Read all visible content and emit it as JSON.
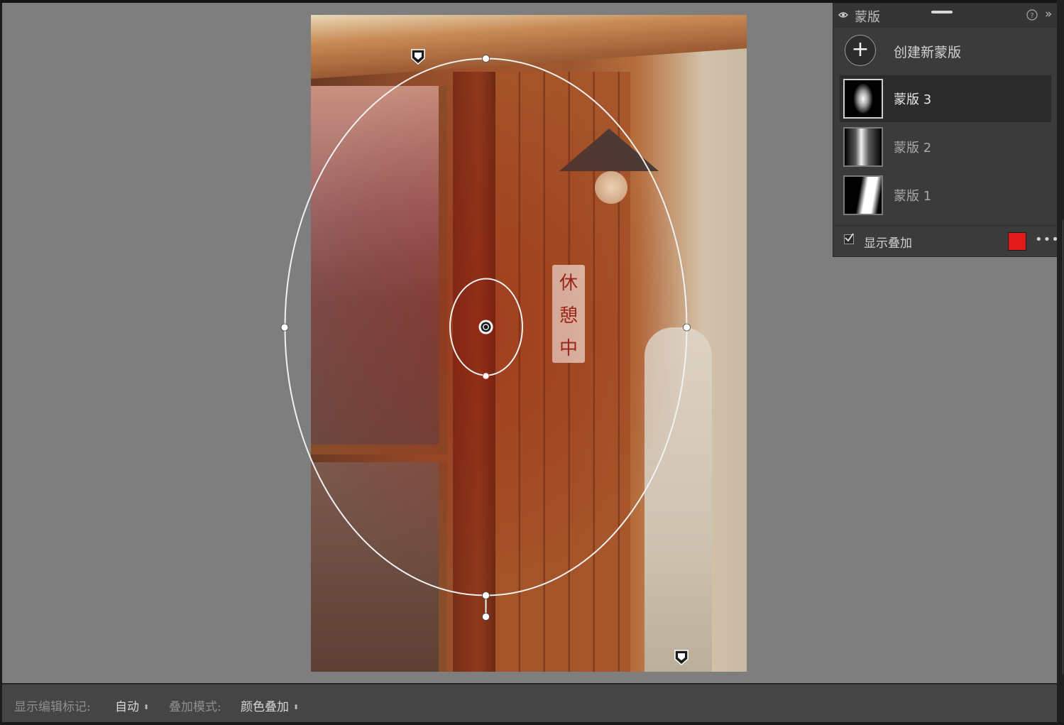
{
  "panel": {
    "title": "蒙版",
    "expand_glyph": "»",
    "create_label": "创建新蒙版",
    "add_glyph": "+",
    "masks": [
      {
        "label": "蒙版 3",
        "selected": true,
        "thumb": "radial-gradient"
      },
      {
        "label": "蒙版 2",
        "selected": false,
        "thumb": "linear-gradient"
      },
      {
        "label": "蒙版 1",
        "selected": false,
        "thumb": "linear-gradient"
      }
    ],
    "show_overlay_label": "显示叠加",
    "show_overlay_checked": true,
    "overlay_color": "#e31a1a",
    "more_glyph": "•••"
  },
  "toolbar": {
    "show_edit_markers_label": "显示编辑标记:",
    "show_edit_markers_value": "自动",
    "overlay_mode_label": "叠加模式:",
    "overlay_mode_value": "颜色叠加",
    "dropdown_glyph": "⬍"
  },
  "photo": {
    "sign_chars": [
      "休",
      "憩",
      "中"
    ]
  }
}
